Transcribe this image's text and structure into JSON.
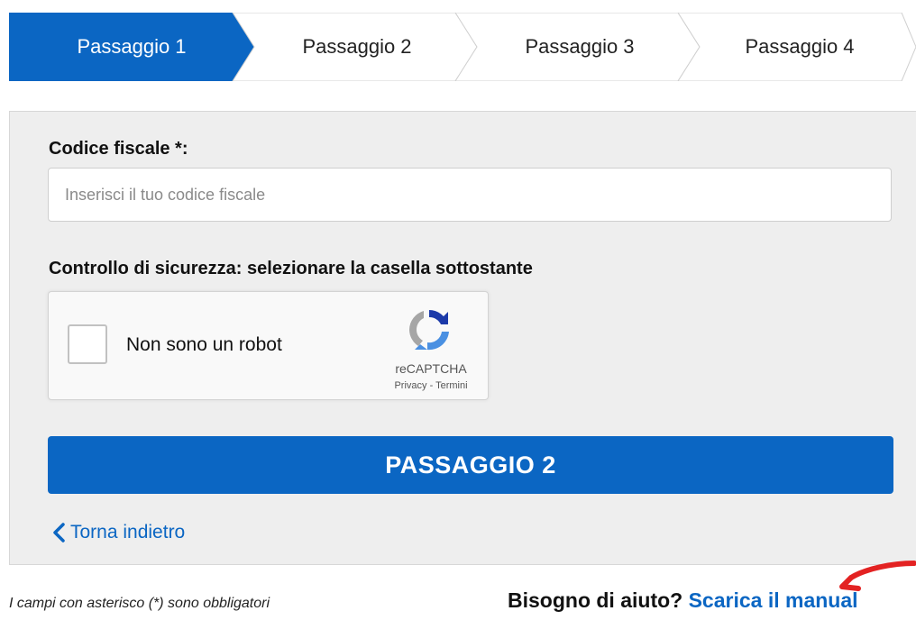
{
  "stepper": {
    "steps": [
      {
        "label": "Passaggio 1",
        "active": true
      },
      {
        "label": "Passaggio 2",
        "active": false
      },
      {
        "label": "Passaggio 3",
        "active": false
      },
      {
        "label": "Passaggio 4",
        "active": false
      }
    ],
    "active_color": "#0b66c3",
    "inactive_color": "#ffffff",
    "border_color": "#d0d0d0"
  },
  "form": {
    "codice_fiscale_label": "Codice fiscale *:",
    "codice_fiscale_placeholder": "Inserisci il tuo codice fiscale",
    "codice_fiscale_value": "",
    "security_label": "Controllo di sicurezza: selezionare la casella sottostante",
    "recaptcha": {
      "checkbox_label": "Non sono un robot",
      "checked": false,
      "brand": "reCAPTCHA",
      "links": "Privacy - Termini",
      "icon": "recaptcha-logo-icon"
    },
    "submit_label": "PASSAGGIO 2",
    "submit_color": "#0b66c3",
    "back_label": "Torna indietro",
    "back_icon": "chevron-left-icon"
  },
  "footer": {
    "required_note": "I campi con asterisco (*) sono obbligatori",
    "help_question": "Bisogno di aiuto?",
    "help_link": "Scarica il manual",
    "annotation_color": "#e32222"
  }
}
